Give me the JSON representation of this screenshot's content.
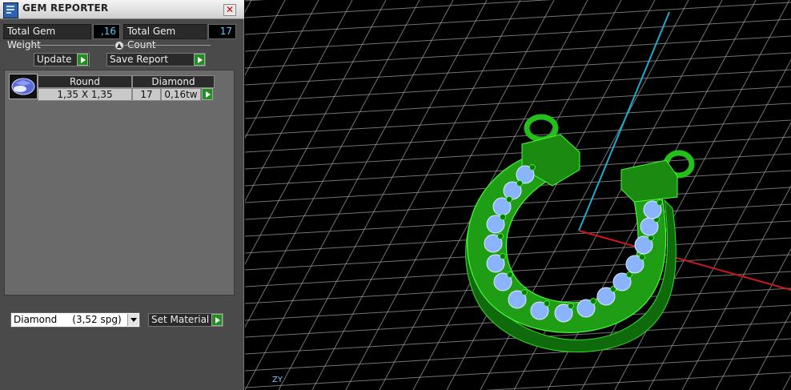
{
  "window": {
    "title": "GEM REPORTER",
    "close_symbol": "✕"
  },
  "summary": {
    "weight_label": "Total Gem Weight",
    "weight_value": ",16",
    "count_label": "Total Gem Count",
    "count_value": "17"
  },
  "actions": {
    "update_label": "Update",
    "save_label": "Save Report"
  },
  "gem_table": {
    "rows": [
      {
        "shape": "Round",
        "material": "Diamond",
        "size": "1,35 X 1,35",
        "count": "17",
        "weight": "0,16tw"
      }
    ]
  },
  "material": {
    "selected_name": "Diamond",
    "selected_density": "(3,52 spg)",
    "set_label": "Set Material"
  },
  "viewport": {
    "axis_label": "ZY",
    "colors": {
      "model": "#22b614",
      "gems": "#8ab4ff",
      "grid": "#9a9a9a",
      "x_axis": "#d01818",
      "y_axis": "#22aacc"
    }
  }
}
